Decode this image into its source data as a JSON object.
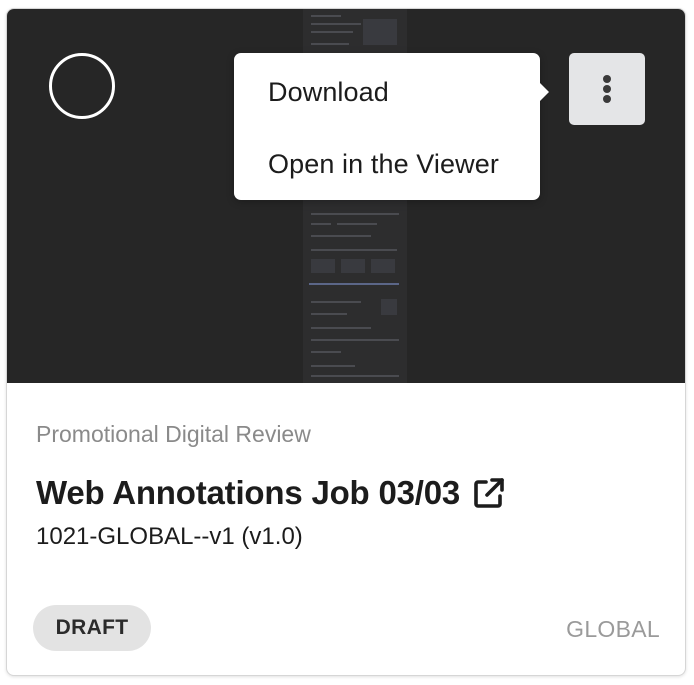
{
  "menu": {
    "items": [
      {
        "label": "Download"
      },
      {
        "label": "Open in the Viewer"
      }
    ]
  },
  "card": {
    "category": "Promotional Digital Review",
    "title": "Web Annotations Job 03/03",
    "document_id": "1021-GLOBAL--v1 (v1.0)",
    "status": "DRAFT",
    "region": "GLOBAL"
  },
  "icons": {
    "select": "circle-select-icon",
    "more": "vertical-ellipsis-icon",
    "external": "external-link-icon"
  },
  "colors": {
    "preview_bg": "#262626",
    "menu_bg": "#ffffff",
    "kebab_bg": "#e4e5e7",
    "badge_bg": "#e3e3e3",
    "muted_text": "#8a8a8a",
    "main_text": "#1c1c1c"
  }
}
